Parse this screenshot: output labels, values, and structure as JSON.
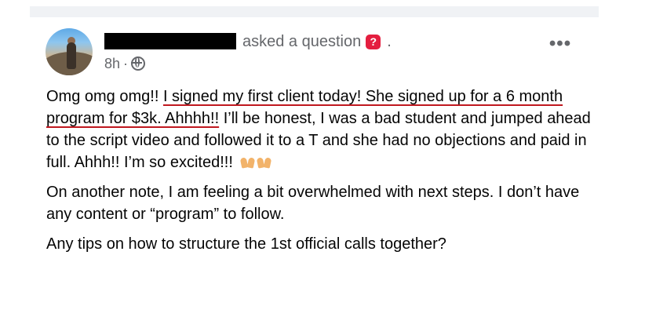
{
  "post": {
    "action_text": "asked a question",
    "action_suffix": ".",
    "question_icon": "question-mark",
    "timestamp": "8h",
    "meta_separator": "·",
    "audience_icon": "globe-icon",
    "more_label": "•••",
    "paragraphs": {
      "p1_before": "Omg omg omg!! ",
      "p1_underlined": "I signed my first client today! She signed up for a 6 month program for $3k. Ahhhh!!",
      "p1_after": " I’ll be honest, I was a bad student and jumped ahead to the script video and followed it to a T and she had no objections and paid in full. Ahhh!! I’m so excited!!!",
      "p2": "On another note, I am feeling a bit overwhelmed with next steps. I don’t have any content or “program” to follow.",
      "p3": "Any tips on how to structure the 1st official calls together?"
    },
    "emoji": [
      "raising-hands",
      "raising-hands"
    ],
    "underline_color": "#c0181f",
    "question_badge_color": "#e41e3f"
  }
}
